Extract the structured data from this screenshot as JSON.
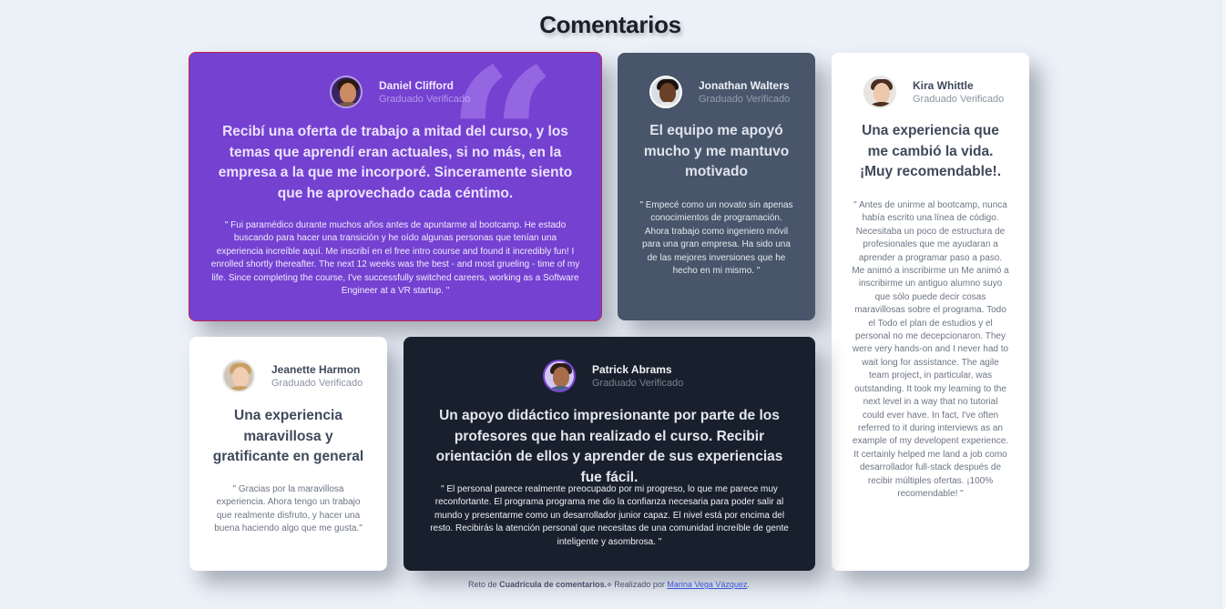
{
  "page": {
    "title": "Comentarios"
  },
  "testimonials": [
    {
      "name": "Daniel Clifford",
      "verified": "Graduado Verificado",
      "headline": "Recibí una oferta de trabajo a mitad del curso, y los temas que aprendí eran actuales, si no más, en la empresa a la que me incorporé. Sinceramente siento que he aprovechado cada céntimo.",
      "quote": "\" Fui paramédico durante muchos años antes de apuntarme al bootcamp. He estado buscando para hacer una transición y he oído algunas personas que tenían una experiencia increíble aquí. Me inscribí en el free intro course and found it incredibly fun! I enrolled shortly thereafter. The next 12 weeks was the best - and most grueling - time of my life. Since completing the course, I've successfully switched careers, working as a Software Engineer at a VR startup. \"",
      "quote_mark": "“"
    },
    {
      "name": "Jonathan Walters",
      "verified": "Graduado Verificado",
      "headline": "El equipo me apoyó mucho y me mantuvo motivado",
      "quote": "\" Empecé como un novato sin apenas conocimientos de programación. Ahora trabajo como ingeniero móvil para una gran empresa. Ha sido una de las mejores inversiones que he hecho en mi mismo. \""
    },
    {
      "name": "Kira Whittle",
      "verified": "Graduado Verificado",
      "headline": "Una experiencia que me cambió la vida. ¡Muy recomendable!.",
      "quote": "\" Antes de unirme al bootcamp, nunca había escrito una línea de código. Necesitaba un poco de estructura de profesionales que me ayudaran a aprender a programar paso a paso. Me animó a inscribirme un Me animó a inscribirme un antiguo alumno suyo que sólo puede decir cosas maravillosas sobre el programa. Todo el Todo el plan de estudios y el personal no me decepcionaron. They were very hands-on and I never had to wait long for assistance. The agile team project, in particular, was outstanding. It took my learning to the next level in a way that no tutorial could ever have. In fact, I've often referred to it during interviews as an example of my developent experience. It certainly helped me land a job como desarrollador full-stack después de recibir múltiples ofertas. ¡100% recomendable! \""
    },
    {
      "name": "Jeanette Harmon",
      "verified": "Graduado Verificado",
      "headline": "Una experiencia maravillosa y gratificante en general",
      "quote": "\" Gracias por la maravillosa experiencia. Ahora tengo un trabajo que realmente disfruto, y hacer una buena haciendo algo que me gusta.\""
    },
    {
      "name": "Patrick Abrams",
      "verified": "Graduado Verificado",
      "headline": "Un apoyo didáctico impresionante por parte de los profesores que han realizado el curso. Recibir orientación de ellos y aprender de sus experiencias fue fácil.",
      "quote": "\" El personal parece realmente preocupado por mi progreso, lo que me parece muy reconfortante. El programa programa me dio la confianza necesaria para poder salir al mundo y presentarme como un desarrollador junior capaz. El nivel está por encima del resto. Recibirás la atención personal que necesitas de una comunidad increíble de gente inteligente y asombrosa. \""
    }
  ],
  "footer": {
    "prefix": "Reto de",
    "challenge": "Cuadrícula de comentarios.",
    "separator": "⋄",
    "made_by": "Realizado por",
    "author": "Marina Vega Vázquez",
    "suffix": "."
  },
  "colors": {
    "background": "#ecf1f8",
    "purple": "#7441d1",
    "gray_blue": "#48556a",
    "dark": "#19202d",
    "white": "#ffffff"
  }
}
